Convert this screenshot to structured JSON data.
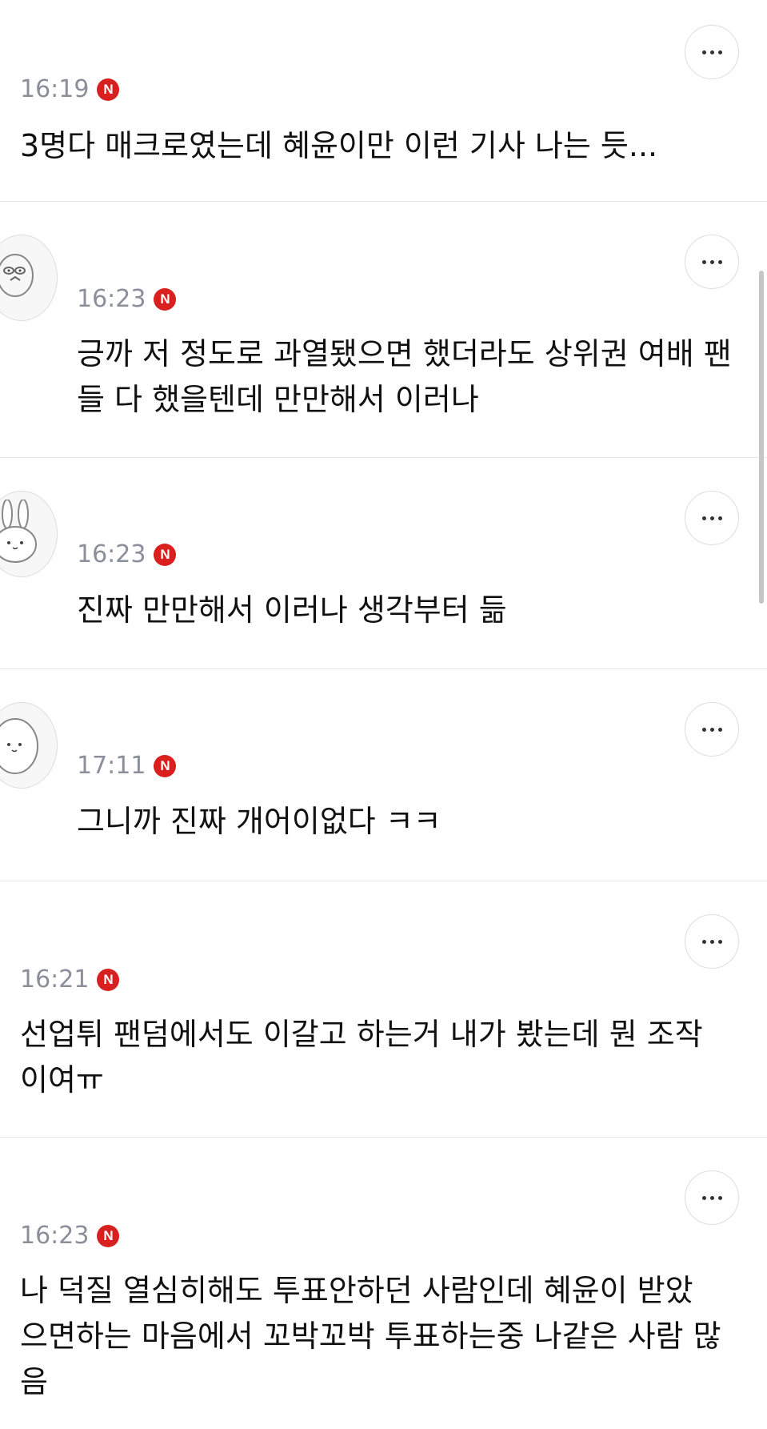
{
  "comments": [
    {
      "time": "16:19",
      "badge": "N",
      "text": "3명다 매크로였는데 혜윤이만 이런 기사 나는 듯...",
      "avatar": null
    },
    {
      "time": "16:23",
      "badge": "N",
      "text": "긍까 저 정도로 과열됐으면 했더라도 상위권 여배 팬들 다 했을텐데 만만해서 이러나",
      "avatar": "character-avatar-icon"
    },
    {
      "time": "16:23",
      "badge": "N",
      "text": "진짜 만만해서 이러나 생각부터 듦",
      "avatar": "rabbit-avatar-icon"
    },
    {
      "time": "17:11",
      "badge": "N",
      "text": "그니까 진짜 개어이없다 ㅋㅋ",
      "avatar": "bear-avatar-icon"
    },
    {
      "time": "16:21",
      "badge": "N",
      "text": "선업튀 팬덤에서도 이갈고 하는거 내가 봤는데 뭔 조작 이여ㅠ",
      "avatar": null
    },
    {
      "time": "16:23",
      "badge": "N",
      "text": "나 덕질 열심히해도 투표안하던 사람인데 혜윤이 받았 으면하는 마음에서 꼬박꼬박 투표하는중 나같은 사람 많음",
      "avatar": null
    }
  ],
  "colors": {
    "badge": "#d9201f",
    "time": "#8a8f99",
    "divider": "#e6e6e6"
  }
}
